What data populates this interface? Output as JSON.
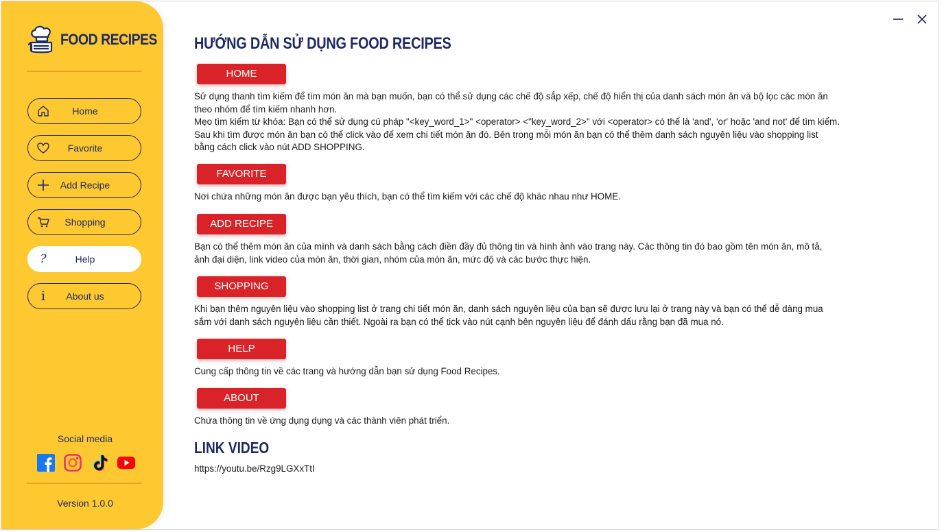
{
  "app": {
    "title": "FOOD RECIPES",
    "version": "Version 1.0.0",
    "social_label": "Social media"
  },
  "colors": {
    "sidebar": "#fdc830",
    "navy": "#1e2a63",
    "pill": "#d92328"
  },
  "nav": [
    {
      "label": "Home",
      "icon": "home-icon"
    },
    {
      "label": "Favorite",
      "icon": "heart-icon"
    },
    {
      "label": "Add Recipe",
      "icon": "plus-icon"
    },
    {
      "label": "Shopping",
      "icon": "cart-icon"
    },
    {
      "label": "Help",
      "icon": "question-icon",
      "active": true
    },
    {
      "label": "About us",
      "icon": "info-icon"
    }
  ],
  "social": [
    "facebook-icon",
    "instagram-icon",
    "tiktok-icon",
    "youtube-icon"
  ],
  "main": {
    "title": "HƯỚNG DẪN SỬ DỤNG FOOD RECIPES",
    "sections": [
      {
        "label": "HOME",
        "lines": [
          "Sử dụng thanh tìm kiếm để tìm món ăn mà bạn muốn, bạn có thể sử dụng các chế độ sắp xếp, chế độ hiển thị của danh sách món ăn và bộ lọc các món ăn",
          "theo nhóm để tìm kiếm nhanh hơn.",
          "Mẹo tìm kiếm từ khóa: Bạn có thể sử dụng cú pháp \"<key_word_1>\" <operator> <\"key_word_2>\" với <operator> có thể là 'and', 'or' hoặc 'and not' để tìm kiếm.",
          "Sau khi tìm được món ăn bạn có thể click vào để xem chi tiết món ăn đó. Bên trong mỗi món ăn bạn có thể thêm danh sách nguyên liệu vào shopping list",
          "bằng cách click vào nút ADD SHOPPING."
        ]
      },
      {
        "label": "FAVORITE",
        "lines": [
          "Nơi chứa những món ăn được bạn yêu thích, bạn có thể tìm kiếm với các chế độ khác nhau như HOME."
        ]
      },
      {
        "label": "ADD RECIPE",
        "lines": [
          "Bạn có thể thêm món ăn của mình và danh sách bằng cách điền đầy đủ thông tin và hình ảnh vào trang này. Các thông tin đó bao gồm tên món ăn, mô tả,",
          "ảnh đại diện, link video của món ăn, thời gian, nhóm của món ăn, mức độ và các bước thực hiện."
        ]
      },
      {
        "label": "SHOPPING",
        "lines": [
          "Khi bạn thêm nguyên liệu vào shopping list ở trang chi tiết món ăn, danh sách nguyên liệu của bạn sẽ được lưu lại ở trang này và bạn có thể dễ dàng mua",
          "sắm với danh sách nguyên liệu cần thiết. Ngoài ra bạn có thể tick vào nút cạnh bên nguyên liệu để đánh dấu rằng bạn đã mua nó."
        ]
      },
      {
        "label": "HELP",
        "lines": [
          "Cung cấp thông tin về các trang và hướng dẫn bạn sử dụng Food Recipes."
        ]
      },
      {
        "label": "ABOUT",
        "lines": [
          "Chứa thông tin về ứng dụng dụng và các thành viên phát triển."
        ]
      }
    ],
    "video_title": "LINK VIDEO",
    "video_link": "https://youtu.be/Rzg9LGXxTtI"
  }
}
